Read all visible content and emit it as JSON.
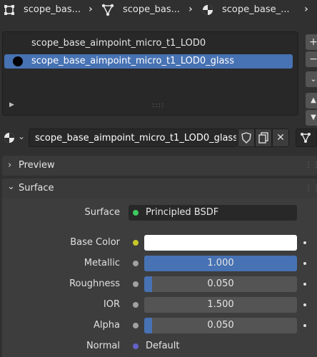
{
  "breadcrumb": {
    "items": [
      "scope_bas...",
      "scope_bas...",
      "scope_base_..."
    ]
  },
  "material_slots": {
    "items": [
      {
        "label": "scope_base_aimpoint_micro_t1_LOD0",
        "selected": false
      },
      {
        "label": "scope_base_aimpoint_micro_t1_LOD0_glass",
        "selected": true
      }
    ]
  },
  "datablock": {
    "material_name": "scope_base_aimpoint_micro_t1_LOD0_glass"
  },
  "panels": {
    "preview": "Preview",
    "surface": "Surface"
  },
  "properties": {
    "surface": {
      "label": "Surface",
      "value": "Principled BSDF",
      "socket_color": "#3fc95f"
    },
    "base_color": {
      "label": "Base Color",
      "color": "#ffffff",
      "socket_color": "#c7c729"
    },
    "metallic": {
      "label": "Metallic",
      "value": "1.000",
      "fraction": 1.0,
      "socket_color": "#a1a1a1"
    },
    "roughness": {
      "label": "Roughness",
      "value": "0.050",
      "fraction": 0.05,
      "socket_color": "#a1a1a1"
    },
    "ior": {
      "label": "IOR",
      "value": "1.500",
      "fraction": 0.0,
      "socket_color": "#a1a1a1"
    },
    "alpha": {
      "label": "Alpha",
      "value": "0.050",
      "fraction": 0.05,
      "socket_color": "#a1a1a1"
    },
    "normal": {
      "label": "Normal",
      "value": "Default",
      "socket_color": "#6363c7"
    }
  },
  "colors": {
    "accent": "#4772b3",
    "panel": "#3d3d3d",
    "field": "#545454"
  }
}
